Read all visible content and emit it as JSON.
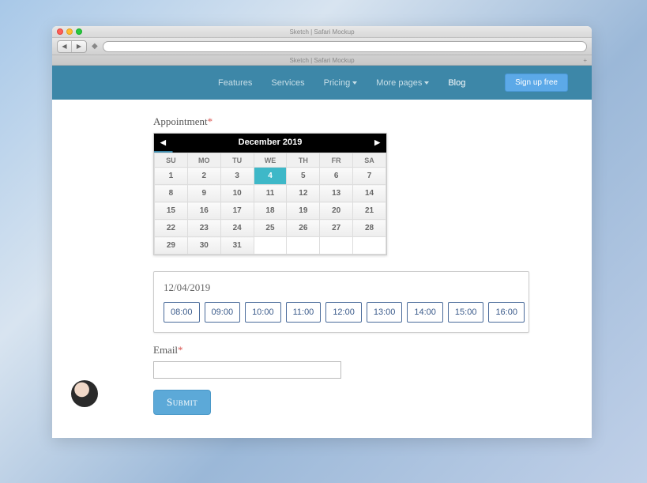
{
  "browser": {
    "title": "Sketch | Safari Mockup",
    "tab": "Sketch | Safari Mockup"
  },
  "nav": {
    "features": "Features",
    "services": "Services",
    "pricing": "Pricing",
    "more": "More pages",
    "blog": "Blog",
    "signup": "Sign up free"
  },
  "form": {
    "appointment_label": "Appointment",
    "email_label": "Email",
    "submit": "Submit",
    "required_marker": "*"
  },
  "calendar": {
    "month": "December 2019",
    "daynames": [
      "SU",
      "MO",
      "TU",
      "WE",
      "TH",
      "FR",
      "SA"
    ],
    "weeks": [
      [
        "1",
        "2",
        "3",
        "4",
        "5",
        "6",
        "7"
      ],
      [
        "8",
        "9",
        "10",
        "11",
        "12",
        "13",
        "14"
      ],
      [
        "15",
        "16",
        "17",
        "18",
        "19",
        "20",
        "21"
      ],
      [
        "22",
        "23",
        "24",
        "25",
        "26",
        "27",
        "28"
      ],
      [
        "29",
        "30",
        "31",
        "",
        "",
        "",
        ""
      ]
    ],
    "selected": "4"
  },
  "timebox": {
    "date": "12/04/2019",
    "slots": [
      "08:00",
      "09:00",
      "10:00",
      "11:00",
      "12:00",
      "13:00",
      "14:00",
      "15:00",
      "16:00"
    ]
  },
  "email_value": ""
}
